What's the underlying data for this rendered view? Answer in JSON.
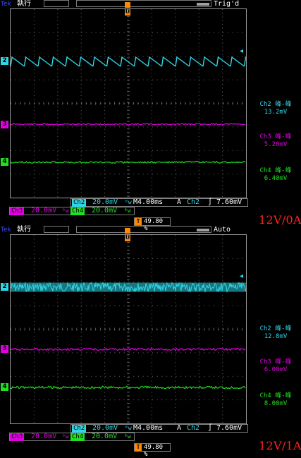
{
  "colors": {
    "ch2": "#2ed6e6",
    "ch3": "#e000e0",
    "ch4": "#20e020",
    "trigger": "#ff8a00",
    "caption": "#ff2020"
  },
  "icons": {
    "trigger_marker": "arrow-down-icon",
    "trigger_t": "T",
    "probe": "wave-icon"
  },
  "panels": [
    {
      "header": {
        "brand": "Tek",
        "run_state": "執行",
        "trigger_state": "Trig'd"
      },
      "marker_letter": "U",
      "channels": [
        {
          "num": "2",
          "arrow": "◂"
        },
        {
          "num": "3"
        },
        {
          "num": "4"
        }
      ],
      "measurements": [
        {
          "label": "Ch2 峰-峰",
          "value": "13.2mV"
        },
        {
          "label": "Ch3 峰-峰",
          "value": "5.20mV"
        },
        {
          "label": "Ch4 峰-峰",
          "value": "6.40mV"
        }
      ],
      "status": {
        "ch2_chip": "Ch2",
        "ch2_scale": "20.0mV",
        "timebase": "M4.00ms",
        "acq": "A",
        "trig_ch": "Ch2",
        "trig_slope": "∫",
        "trig_level": "7.60mV",
        "ch3_chip": "Ch3",
        "ch3_scale": "20.0mV",
        "ch4_chip": "Ch4",
        "ch4_scale": "20.0mV",
        "bw": "ᴮw",
        "trig_pos": "49.80 %"
      },
      "caption": "12V/0A",
      "ch2_trace": "sawtooth"
    },
    {
      "header": {
        "brand": "Tek",
        "run_state": "執行",
        "trigger_state": "Auto"
      },
      "marker_letter": "U",
      "channels": [
        {
          "num": "2",
          "arrow": "◂"
        },
        {
          "num": "3"
        },
        {
          "num": "4"
        }
      ],
      "measurements": [
        {
          "label": "Ch2 峰-峰",
          "value": "12.8mV"
        },
        {
          "label": "Ch3 峰-峰",
          "value": "6.00mV"
        },
        {
          "label": "Ch4 峰-峰",
          "value": "8.00mV"
        }
      ],
      "status": {
        "ch2_chip": "Ch2",
        "ch2_scale": "20.0mV",
        "timebase": "M4.00ms",
        "acq": "A",
        "trig_ch": "Ch2",
        "trig_slope": "∫",
        "trig_level": "7.60mV",
        "ch3_chip": "Ch3",
        "ch3_scale": "20.0mV",
        "ch4_chip": "Ch4",
        "ch4_scale": "20.0mV",
        "bw": "ᴮw",
        "trig_pos": "49.80 %"
      },
      "caption": "12V/1A",
      "ch2_trace": "noise-band"
    }
  ]
}
